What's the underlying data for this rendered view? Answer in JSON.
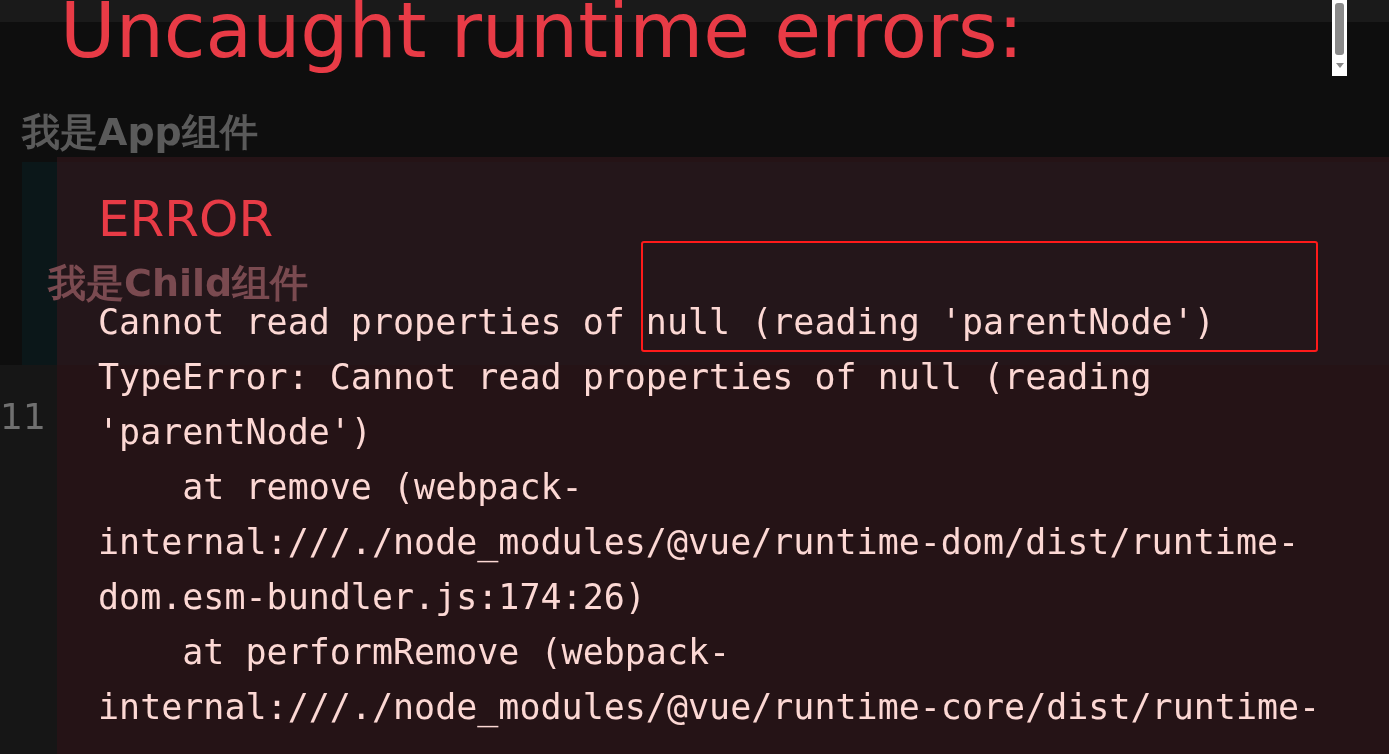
{
  "page": {
    "heading": "我是App组件",
    "child": {
      "heading": "我是Child组件"
    },
    "line_number": "11"
  },
  "overlay": {
    "title": "Uncaught runtime errors:",
    "error": {
      "label": "ERROR",
      "message": "Cannot read properties of null (reading 'parentNode')",
      "stack": [
        "TypeError: Cannot read properties of null (reading",
        "'parentNode')",
        "    at remove (webpack-",
        "internal:///./node_modules/@vue/runtime-dom/dist/runtime-",
        "dom.esm-bundler.js:174:26)",
        "    at performRemove (webpack-",
        "internal:///./node_modules/@vue/runtime-core/dist/runtime-"
      ]
    }
  }
}
